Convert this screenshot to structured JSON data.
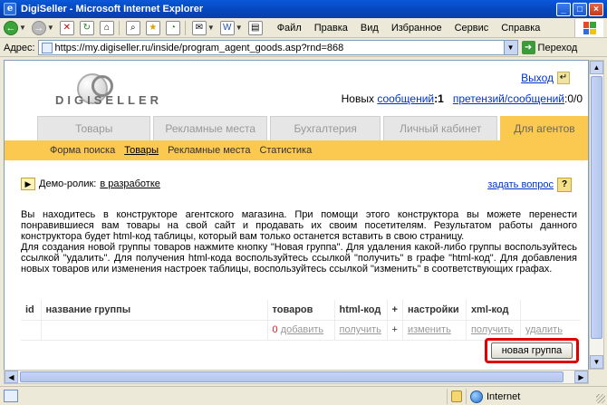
{
  "window": {
    "title": "DigiSeller - Microsoft Internet Explorer",
    "app_icon": "e"
  },
  "window_controls": {
    "minimize": "_",
    "maximize": "□",
    "close": "×"
  },
  "toolbar": {
    "back": "Назад",
    "menus": [
      "Файл",
      "Правка",
      "Вид",
      "Избранное",
      "Сервис",
      "Справка"
    ]
  },
  "address": {
    "label": "Адрес:",
    "url": "https://my.digiseller.ru/inside/program_agent_goods.asp?rnd=868",
    "go_label": "Переход"
  },
  "header": {
    "logo_text": "DIGISELLER",
    "exit_label": "Выход",
    "new_label": "Новых",
    "messages_link": "сообщений",
    "messages_count": ":1",
    "claims_link": "претензий/сообщений",
    "claims_count": ":0/0"
  },
  "tabs": [
    {
      "label": "Товары",
      "active": false
    },
    {
      "label": "Рекламные места",
      "active": false
    },
    {
      "label": "Бухгалтерия",
      "active": false
    },
    {
      "label": "Личный кабинет",
      "active": false
    },
    {
      "label": "Для агентов",
      "active": true
    }
  ],
  "subnav": [
    {
      "label": "Форма поиска",
      "current": false
    },
    {
      "label": "Товары",
      "current": true
    },
    {
      "label": "Рекламные места",
      "current": false
    },
    {
      "label": "Статистика",
      "current": false
    }
  ],
  "demo": {
    "label": "Демо-ролик:",
    "link": "в разработке"
  },
  "ask": {
    "link": "задать вопрос"
  },
  "paragraphs": [
    "Вы находитесь в конструкторе агентского магазина. При помощи этого конструктора вы можете перенести понравившиеся вам товары на свой сайт и продавать их своим посетителям. Результатом работы данного конструктора будет html-код таблицы, который вам только останется вставить в свою страницу.",
    "Для создания новой группы товаров нажмите кнопку \"Новая группа\". Для удаления какой-либо группы воспользуйтесь ссылкой \"удалить\". Для получения html-кода воспользуйтесь ссылкой \"получить\" в графе \"html-код\". Для добавления новых товаров или изменения настроек таблицы, воспользуйтесь ссылкой \"изменить\" в соответствующих графах."
  ],
  "table": {
    "headers": [
      "id",
      "название группы",
      "товаров",
      "html-код",
      "+",
      "настройки",
      "xml-код",
      ""
    ],
    "row": {
      "id": "",
      "name": "",
      "count": "0",
      "add": "добавить",
      "html_get": "получить",
      "plus": "+",
      "settings": "изменить",
      "xml_get": "получить",
      "delete": "удалить"
    }
  },
  "new_group_button": "новая группа",
  "status": {
    "zone": "Internet"
  },
  "colors": {
    "accent": "#fbc850",
    "link": "#0033cc",
    "highlight": "#e00000"
  }
}
